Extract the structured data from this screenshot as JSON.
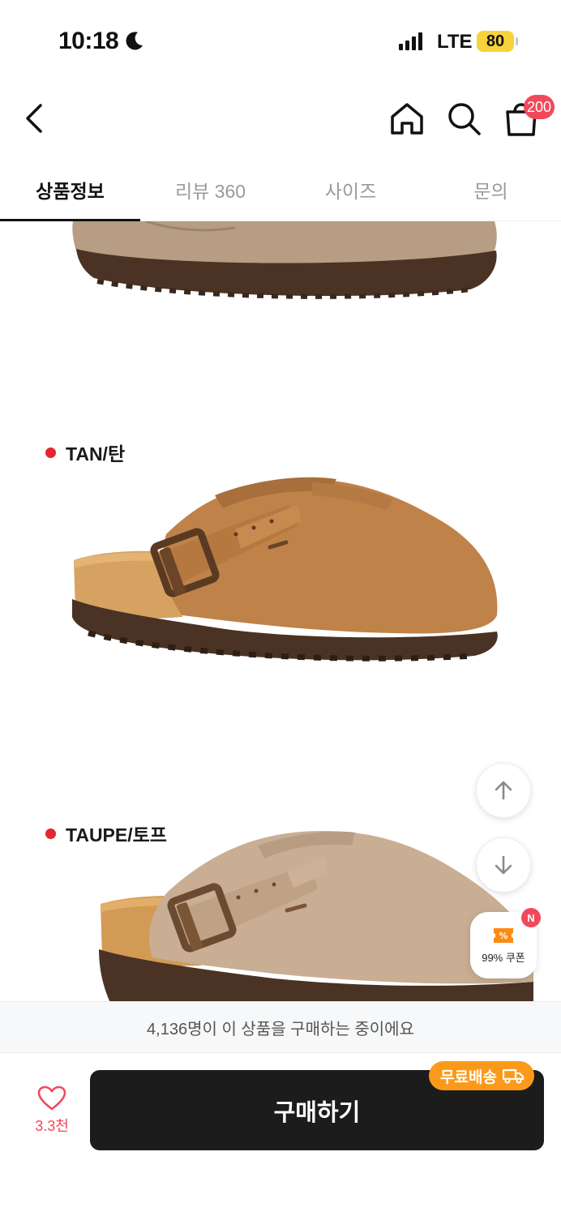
{
  "status_bar": {
    "time": "10:18",
    "network": "LTE",
    "battery": "80"
  },
  "header": {
    "cart_count": "200"
  },
  "tabs": [
    {
      "label": "상품정보",
      "active": true
    },
    {
      "label": "리뷰 360",
      "active": false
    },
    {
      "label": "사이즈",
      "active": false
    },
    {
      "label": "문의",
      "active": false
    }
  ],
  "product_colors": [
    {
      "label": "TAN/탄",
      "color": "#c0834d"
    },
    {
      "label": "TAUPE/토프",
      "color": "#c8ab90"
    }
  ],
  "coupon": {
    "label": "99% 쿠폰",
    "badge": "N"
  },
  "buyers_notice": "4,136명이 이 상품을 구매하는 중이에요",
  "bottom": {
    "like_count": "3.3천",
    "buy_label": "구매하기",
    "shipping_badge": "무료배송"
  },
  "colors": {
    "accent_red": "#f2495a",
    "shipping_orange": "#fb9a1a",
    "buy_button": "#1c1c1c"
  }
}
